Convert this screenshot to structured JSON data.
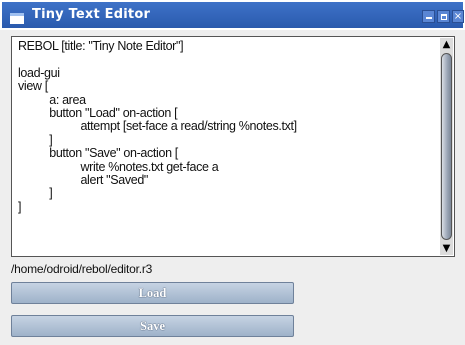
{
  "window": {
    "title": "Tiny Text Editor",
    "controls": {
      "minimize": "minimize-icon",
      "maximize": "maximize-icon",
      "close": "×"
    }
  },
  "editor": {
    "content": "REBOL [title: \"Tiny Note Editor\"]\n\nload-gui\nview [\n          a: area\n          button \"Load\" on-action [\n                    attempt [set-face a read/string %notes.txt]\n          ]\n          button \"Save\" on-action [\n                    write %notes.txt get-face a\n                    alert \"Saved\"\n          ]\n]",
    "scroll": {
      "up": "▲",
      "down": "▼"
    }
  },
  "status": {
    "path": "/home/odroid/rebol/editor.r3"
  },
  "buttons": {
    "load": "Load",
    "save": "Save"
  }
}
